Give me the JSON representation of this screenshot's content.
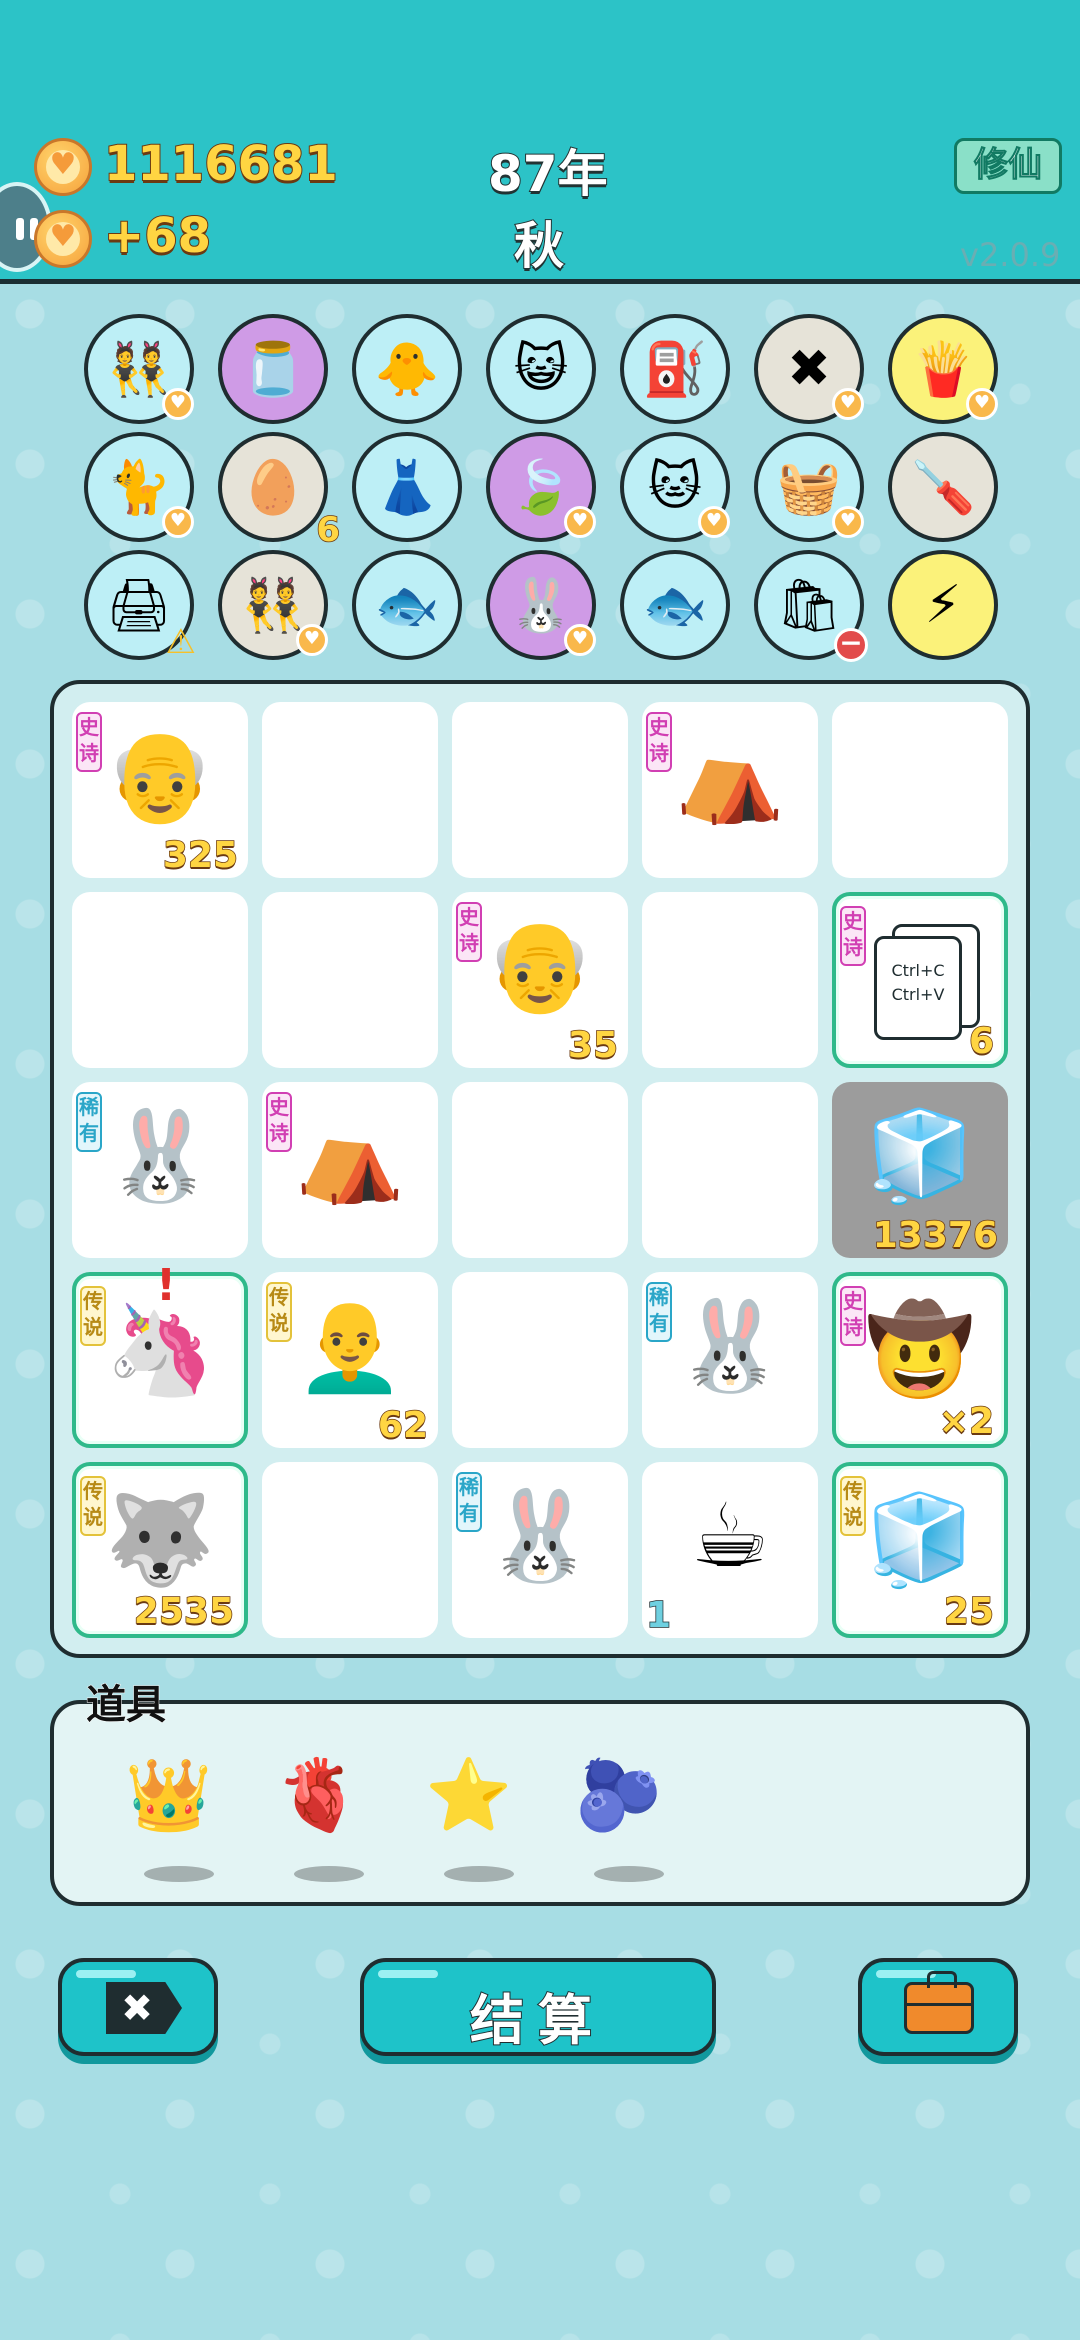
{
  "header": {
    "coins": "1116681",
    "coin_delta": "+68",
    "year": "87年",
    "season": "秋",
    "xiuxian_label": "修仙",
    "version": "v2.0.9"
  },
  "items": [
    {
      "name": "twin-girls-item",
      "emoji": "👯",
      "bg": "#bdeff6",
      "badge": "heart"
    },
    {
      "name": "jar-item",
      "emoji": "🫙",
      "bg": "#cf9be6"
    },
    {
      "name": "chick-egg-item",
      "emoji": "🐥",
      "bg": "#bdeff6"
    },
    {
      "name": "cool-cat-item",
      "emoji": "😺",
      "bg": "#bdeff6"
    },
    {
      "name": "pump-item",
      "emoji": "⛽",
      "bg": "#bdeff6"
    },
    {
      "name": "delete-tag-item",
      "emoji": "✖",
      "bg": "#e6e3d8",
      "badge": "heart"
    },
    {
      "name": "fries-item",
      "emoji": "🍟",
      "bg": "#fbf27a",
      "badge": "heart"
    },
    {
      "name": "gray-cat-item",
      "emoji": "🐈",
      "bg": "#bdeff6",
      "badge": "heart"
    },
    {
      "name": "egg-tray-item",
      "emoji": "🥚",
      "bg": "#e6e3d8",
      "count": "6"
    },
    {
      "name": "skirt-item",
      "emoji": "👗",
      "bg": "#bdeff6"
    },
    {
      "name": "leaf-item",
      "emoji": "🍃",
      "bg": "#cf9be6",
      "badge": "heart"
    },
    {
      "name": "cat-back-item",
      "emoji": "🐱",
      "bg": "#bdeff6",
      "badge": "heart"
    },
    {
      "name": "fruit-basket-item",
      "emoji": "🧺",
      "bg": "#bdeff6",
      "badge": "heart"
    },
    {
      "name": "screwdriver-item",
      "emoji": "🪛",
      "bg": "#e6e3d8"
    },
    {
      "name": "printer-item",
      "emoji": "🖨",
      "bg": "#bdeff6",
      "badge": "warn"
    },
    {
      "name": "twin-girls-item-2",
      "emoji": "👯",
      "bg": "#e6e3d8",
      "badge": "heart"
    },
    {
      "name": "fishbowl-item",
      "emoji": "🐟",
      "bg": "#bdeff6"
    },
    {
      "name": "bunny-item",
      "emoji": "🐰",
      "bg": "#cf9be6",
      "badge": "heart"
    },
    {
      "name": "fishbowl-item-2",
      "emoji": "🐟",
      "bg": "#bdeff6"
    },
    {
      "name": "trash-bag-item",
      "emoji": "🛍",
      "bg": "#bdeff6",
      "badge": "minus"
    },
    {
      "name": "lightning-item",
      "emoji": "⚡",
      "bg": "#fbf27a"
    }
  ],
  "board": {
    "cells": [
      {
        "tag": "史诗",
        "tag_type": "epic",
        "emoji": "👴",
        "num": "325"
      },
      {},
      {},
      {
        "tag": "史诗",
        "tag_type": "epic",
        "emoji": "⛺"
      },
      {},
      {},
      {},
      {
        "tag": "史诗",
        "tag_type": "epic",
        "emoji": "👴",
        "num": "35"
      },
      {},
      {
        "tag": "史诗",
        "tag_type": "epic",
        "ctrl": true,
        "num": "6",
        "highlight": true
      },
      {
        "tag": "稀有",
        "tag_type": "rare",
        "emoji": "🐰"
      },
      {
        "tag": "史诗",
        "tag_type": "epic",
        "emoji": "⛺"
      },
      {},
      {},
      {
        "emoji": "🧊",
        "num": "13376",
        "dark": true
      },
      {
        "tag": "传说",
        "tag_type": "legend",
        "emoji": "🦄",
        "highlight": true,
        "exclaim": "!"
      },
      {
        "tag": "传说",
        "tag_type": "legend",
        "emoji": "👨‍🦲",
        "num": "62"
      },
      {},
      {
        "tag": "稀有",
        "tag_type": "rare",
        "emoji": "🐰"
      },
      {
        "tag": "史诗",
        "tag_type": "epic",
        "emoji": "🤠",
        "num": "×2",
        "highlight": true
      },
      {
        "tag": "传说",
        "tag_type": "legend",
        "emoji": "🐺",
        "num": "2535",
        "highlight": true
      },
      {},
      {
        "tag": "稀有",
        "tag_type": "rare",
        "emoji": "🐰"
      },
      {
        "emoji": "☕",
        "num_left": "1"
      },
      {
        "tag": "传说",
        "tag_type": "legend",
        "emoji": "🧊",
        "num": "25",
        "highlight": true
      }
    ],
    "ctrl_c": "Ctrl+C",
    "ctrl_v": "Ctrl+V"
  },
  "props": {
    "title": "道具",
    "items": [
      {
        "name": "crown-prop",
        "emoji": "👑"
      },
      {
        "name": "liver-prop",
        "emoji": "🫀"
      },
      {
        "name": "star-prop",
        "emoji": "⭐"
      },
      {
        "name": "blueberry-prop",
        "emoji": "🫐"
      }
    ]
  },
  "buttons": {
    "close_icon": "✖",
    "settle_label": "结算"
  }
}
